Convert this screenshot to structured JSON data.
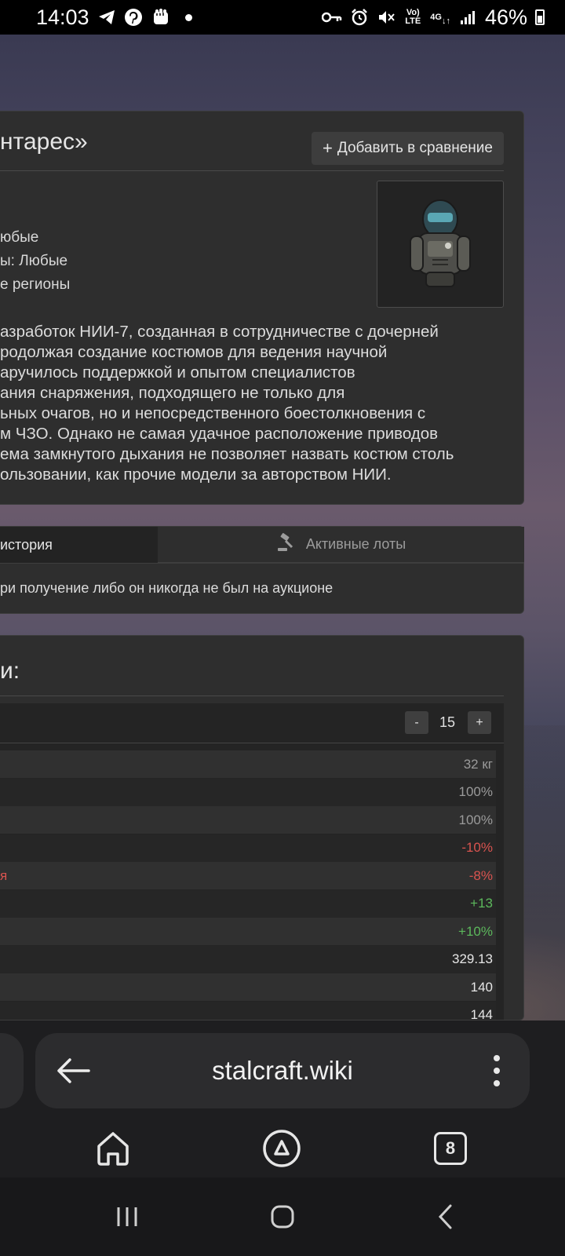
{
  "status_bar": {
    "time": "14:03",
    "battery": "46%",
    "network": "4G",
    "volte": "Vo) LTE",
    "left_icons": [
      "telegram-icon",
      "pinterest-icon",
      "fist-icon",
      "dot-icon"
    ],
    "right_icons": [
      "key-icon",
      "alarm-icon",
      "mute-icon",
      "volte-icon",
      "4g-icon",
      "signal-icon",
      "battery-icon"
    ]
  },
  "item": {
    "title": "нтарес»",
    "compare_button": "Добавить в сравнение",
    "compare_icon": "plus-icon",
    "meta": [
      "юбые",
      "ы: Любые",
      "е регионы"
    ],
    "image_icon": "armor-suit-icon",
    "description_lines": [
      "азработок НИИ-7, созданная в сотрудничестве с дочерней",
      "родолжая создание костюмов для ведения научной",
      "аручилось поддержкой и опытом специалистов",
      "ания снаряжения, подходящего не только для",
      "ьных очагов, но и непосредственного боестолкновения с",
      "м ЧЗО. Однако не самая удачное расположение приводов",
      "ема замкнутого дыхания не позволяет назвать костюм столь",
      "ользовании, как прочие модели за авторством НИИ."
    ]
  },
  "auction": {
    "tab_history": "история",
    "tab_active": "Активные лоты",
    "tab_active_icon": "gavel-icon",
    "message": "ри получение либо он никогда не был на аукционе"
  },
  "stats": {
    "title": "и:",
    "level_minus": "-",
    "level_value": "15",
    "level_plus": "+",
    "rows": [
      {
        "label": "",
        "value": "32 кг",
        "value_color": "#9a9a9a"
      },
      {
        "label": "",
        "value": "100%",
        "value_color": "#9a9a9a"
      },
      {
        "label": "",
        "value": "100%",
        "value_color": "#9a9a9a"
      },
      {
        "label": "",
        "value": "-10%",
        "value_color": "#d9534f"
      },
      {
        "label": "я",
        "value": "-8%",
        "value_color": "#d9534f"
      },
      {
        "label": "",
        "value": "+13",
        "value_color": "#5cb85c"
      },
      {
        "label": "",
        "value": "+10%",
        "value_color": "#5cb85c"
      },
      {
        "label": "",
        "value": "329.13",
        "value_color": "#e6e6e6"
      },
      {
        "label": "",
        "value": "140",
        "value_color": "#e6e6e6"
      },
      {
        "label": "",
        "value": "144",
        "value_color": "#e6e6e6"
      }
    ],
    "label_color": "#d9534f"
  },
  "browser": {
    "url": "stalcraft.wiki",
    "tab_count": "8",
    "back_icon": "arrow-left-icon",
    "menu_icon": "more-vertical-icon",
    "home_icon": "home-icon",
    "assistant_icon": "alice-icon"
  },
  "system_nav": {
    "recents_icon": "recents-icon",
    "home_icon": "home-circle-icon",
    "back_icon": "back-chevron-icon"
  }
}
